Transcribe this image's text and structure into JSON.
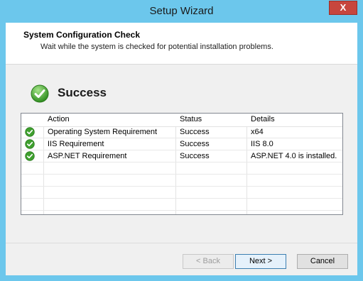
{
  "window": {
    "title": "Setup Wizard",
    "close_glyph": "X"
  },
  "header": {
    "title": "System Configuration Check",
    "subtitle": "Wait while the system is checked for potential installation problems."
  },
  "result": {
    "icon": "check-circle-icon",
    "status": "Success"
  },
  "grid": {
    "columns": [
      "Action",
      "Status",
      "Details"
    ],
    "rows": [
      {
        "icon": "check-icon",
        "action": "Operating System Requirement",
        "status": "Success",
        "details": "x64"
      },
      {
        "icon": "check-icon",
        "action": "IIS Requirement",
        "status": "Success",
        "details": "IIS 8.0"
      },
      {
        "icon": "check-icon",
        "action": "ASP.NET Requirement",
        "status": "Success",
        "details": "ASP.NET 4.0 is installed."
      }
    ]
  },
  "buttons": {
    "back": "< Back",
    "next": "Next >",
    "cancel": "Cancel"
  },
  "colors": {
    "accent": "#6cc7ec",
    "success": "#3fa02f",
    "close": "#c7463d"
  }
}
